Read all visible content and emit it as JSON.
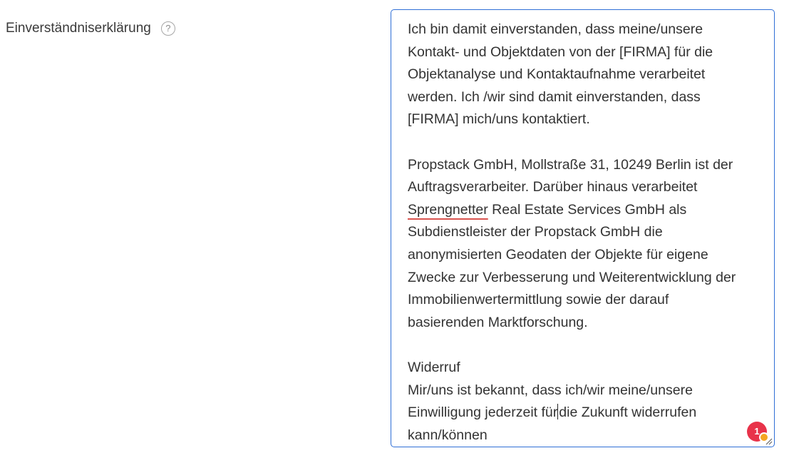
{
  "field": {
    "label": "Einverständniserklärung",
    "help_icon": "question-circle-icon",
    "help_glyph": "?"
  },
  "textarea": {
    "lines": [
      "Ich bin damit einverstanden, dass meine/unsere",
      "Kontakt- und Objektdaten von der [FIRMA] für die",
      "Objektanalyse und Kontaktaufnahme verarbeitet",
      "werden. Ich /wir sind damit einverstanden, dass",
      "[FIRMA] mich/uns kontaktiert.",
      "",
      "Propstack GmbH, Mollstraße 31, 10249 Berlin ist der",
      "Auftragsverarbeiter. Darüber hinaus verarbeitet",
      "Real Estate Services GmbH als",
      "Subdienstleister der Propstack GmbH die",
      "anonymisierten Geodaten der Objekte für eigene",
      "Zwecke zur Verbesserung und Weiterentwicklung der",
      "Immobilienwertermittlung sowie der darauf",
      "basierenden Marktforschung.",
      "",
      "Widerruf",
      "Mir/uns ist bekannt, dass ich/wir meine/unsere",
      "Einwilligung jederzeit für",
      "die Zukunft widerrufen",
      "kann/können"
    ],
    "misspelled_word": "Sprengnetter",
    "border_color": "#2f6fd6"
  },
  "grammar_badge": {
    "count": "1",
    "color": "#e8334a",
    "dot_color": "#f5a623"
  }
}
